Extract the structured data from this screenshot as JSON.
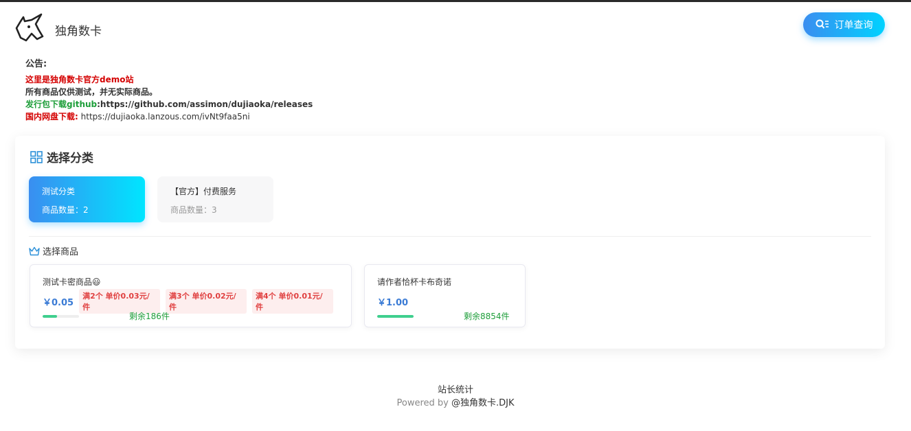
{
  "header": {
    "site_title": "独角数卡",
    "order_query_label": "订单查询"
  },
  "notice": {
    "label": "公告:",
    "line1": "这里是独角数卡官方demo站",
    "line2": "所有商品仅供测试，并无实际商品。",
    "line3_label": "发行包下载github",
    "line3_value": ":https://github.com/assimon/dujiaoka/releases",
    "line4_label": "国内网盘下载:",
    "line4_value": " https://dujiaoka.lanzous.com/ivNt9faa5ni"
  },
  "category_section": {
    "title": "选择分类",
    "categories": [
      {
        "name": "测试分类",
        "count": "商品数量：2",
        "active": true
      },
      {
        "name": "【官方】付费服务",
        "count": "商品数量：3",
        "active": false
      }
    ]
  },
  "goods_section": {
    "title": "选择商品",
    "goods": [
      {
        "name": "测试卡密商品😃",
        "price": "￥0.05",
        "tags": [
          "满2个 单价0.03元/件",
          "满3个 单价0.02元/件",
          "满4个 单价0.01元/件"
        ],
        "stock": "剩余186件",
        "stock_fill_fraction": 0.4
      },
      {
        "name": "请作者恰杯卡布奇诺",
        "price": "￥1.00",
        "tags": [],
        "stock": "剩余8854件",
        "stock_fill_fraction": 1.0
      }
    ]
  },
  "footer": {
    "stat": "站长统计",
    "powered_prefix": "Powered by ",
    "powered_brand": "@独角数卡.DJK"
  },
  "colors": {
    "accent_start": "#3a8ef0",
    "accent_end": "#00d2ff",
    "price_blue": "#3a7bd5",
    "notice_red": "#d40000",
    "notice_green": "#1e9e3a",
    "tag_red": "#e04040",
    "stock_green": "#3fcf8e"
  }
}
